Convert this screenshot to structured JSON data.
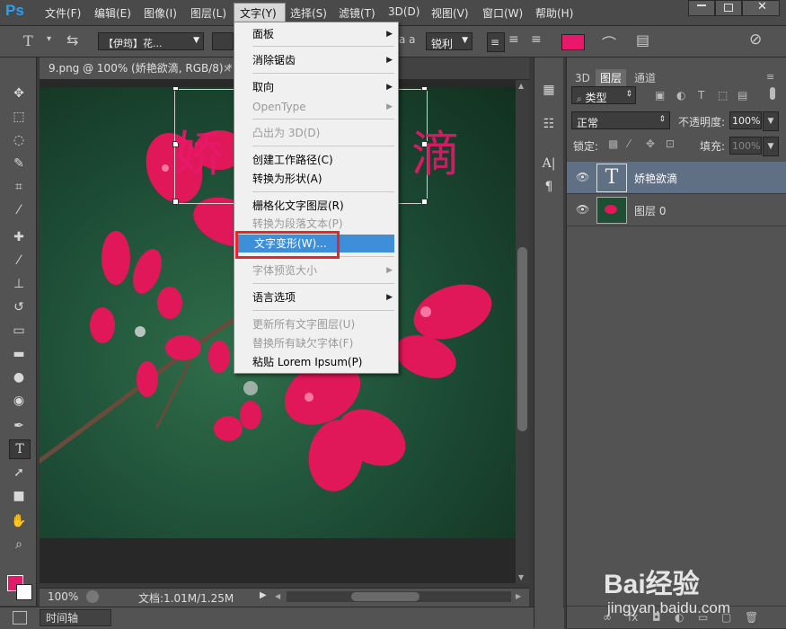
{
  "app": {
    "logo": "Ps"
  },
  "menubar": {
    "items": [
      "文件(F)",
      "编辑(E)",
      "图像(I)",
      "图层(L)",
      "文字(Y)",
      "选择(S)",
      "滤镜(T)",
      "3D(D)",
      "视图(V)",
      "窗口(W)",
      "帮助(H)"
    ],
    "active": "文字(Y)"
  },
  "options": {
    "font_family": "【伊筠】花...",
    "anti_alias": "锐利",
    "size_glyph": "a a",
    "text_color": "#e8186a"
  },
  "document": {
    "tab_title": "9.png @ 100% (娇艳欲滴, RGB/8) *",
    "zoom": "100%",
    "doc_size": "文档:1.01M/1.25M",
    "overlay_text": "娇艳欲滴"
  },
  "timeline": {
    "label": "时间轴"
  },
  "layers_panel": {
    "tabs": [
      "3D",
      "图层",
      "通道"
    ],
    "active_tab": "图层",
    "filter_kind": "类型",
    "blend_mode": "正常",
    "opacity_label": "不透明度:",
    "opacity_value": "100%",
    "lock_label": "锁定:",
    "fill_label": "填充:",
    "fill_value": "100%",
    "layers": [
      {
        "name": "娇艳欲滴",
        "type": "text",
        "selected": true
      },
      {
        "name": "图层 0",
        "type": "image",
        "selected": false
      }
    ]
  },
  "dropdown": {
    "items": [
      {
        "label": "面板",
        "submenu": true,
        "disabled": false
      },
      {
        "label": "消除锯齿",
        "submenu": true,
        "disabled": false
      },
      {
        "label": "取向",
        "submenu": true,
        "disabled": false
      },
      {
        "label": "OpenType",
        "submenu": true,
        "disabled": true
      },
      {
        "label": "凸出为 3D(D)",
        "submenu": false,
        "disabled": true
      },
      {
        "label": "创建工作路径(C)",
        "submenu": false,
        "disabled": false
      },
      {
        "label": "转换为形状(A)",
        "submenu": false,
        "disabled": false
      },
      {
        "label": "栅格化文字图层(R)",
        "submenu": false,
        "disabled": false
      },
      {
        "label": "转换为段落文本(P)",
        "submenu": false,
        "disabled": true
      },
      {
        "label": "文字变形(W)...",
        "submenu": false,
        "disabled": false,
        "highlighted": true
      },
      {
        "label": "字体预览大小",
        "submenu": true,
        "disabled": true
      },
      {
        "label": "语言选项",
        "submenu": true,
        "disabled": false
      },
      {
        "label": "更新所有文字图层(U)",
        "submenu": false,
        "disabled": true
      },
      {
        "label": "替换所有缺欠字体(F)",
        "submenu": false,
        "disabled": true
      },
      {
        "label": "粘贴 Lorem Ipsum(P)",
        "submenu": false,
        "disabled": false
      }
    ]
  },
  "watermark": {
    "brand": "Bai经验",
    "url": "jingyan.baidu.com"
  },
  "colors": {
    "accent_pink": "#e8186a",
    "highlight_blue": "#3e8fda",
    "annotation_red": "#e8252a"
  }
}
